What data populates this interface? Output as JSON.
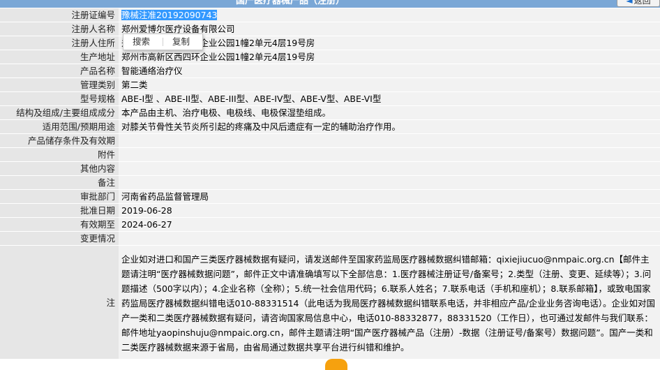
{
  "header": {
    "title": "国产医疗器械产品（注册）",
    "back_label": "返回"
  },
  "context_menu": {
    "search_label": "搜索",
    "copy_label": "复制"
  },
  "fields": [
    {
      "label": "注册证编号",
      "value": "豫械注准20192090743",
      "selected": true
    },
    {
      "label": "注册人名称",
      "value": "郑州爱博尔医疗设备有限公司"
    },
    {
      "label": "注册人住所",
      "value": "郑州市高新区西四环企业公园1幢2单元4层19号房"
    },
    {
      "label": "生产地址",
      "value": "郑州市高新区西四环企业公园1幢2单元4层19号房"
    },
    {
      "label": "产品名称",
      "value": "智能通络治疗仪"
    },
    {
      "label": "管理类别",
      "value": "第二类"
    },
    {
      "label": "型号规格",
      "value": "ABE-I型 、ABE-II型、ABE-III型、ABE-IV型、ABE-V型、ABE-VI型"
    },
    {
      "label": "结构及组成/主要组成成分",
      "value": "本产品由主机、治疗电极、电极线、电极保湿垫组成。"
    },
    {
      "label": "适用范围/预期用途",
      "value": "对膝关节骨性关节炎所引起的疼痛及中风后遗症有一定的辅助治疗作用。"
    },
    {
      "label": "产品储存条件及有效期",
      "value": ""
    },
    {
      "label": "附件",
      "value": ""
    },
    {
      "label": "其他内容",
      "value": ""
    },
    {
      "label": "备注",
      "value": ""
    },
    {
      "label": "审批部门",
      "value": "河南省药品监督管理局"
    },
    {
      "label": "批准日期",
      "value": "2019-06-28"
    },
    {
      "label": "有效期至",
      "value": "2024-06-27"
    },
    {
      "label": "变更情况",
      "value": ""
    }
  ],
  "note": {
    "label": "注",
    "text": "企业如对进口和国产三类医疗器械数据有疑问，请发送邮件至国家药监局医疗器械数据纠错邮箱：qixiejiucuo@nmpaic.org.cn【邮件主题请注明“医疗器械数据问题”，邮件正文中请准确填写以下全部信息：1.医疗器械注册证号/备案号；2.类型（注册、变更、延续等）；3.问题描述（500字以内）；4.企业名称（全称）；5.统一社会信用代码；6.联系人姓名；7.联系电话（手机和座机）；8.联系邮箱】，或致电国家药监局医疗器械数据纠错电话010-88331514（此电话为我局医疗器械数据纠错联系电话，并非相应产品/企业业务咨询电话）。企业如对国产一类和二类医疗器械数据有疑问，请咨询国家局信息中心，电话010-88332877，88331520（工作日），也可通过发邮件与我们联系：邮件地址yaopinshuju@nmpaic.org.cn，邮件主题请注明“国产医疗器械产品（注册）-数据（注册证号/备案号）数据问题”。国产一类和二类医疗器械数据来源于省局，由省局通过数据共享平台进行纠错和维护。"
  }
}
